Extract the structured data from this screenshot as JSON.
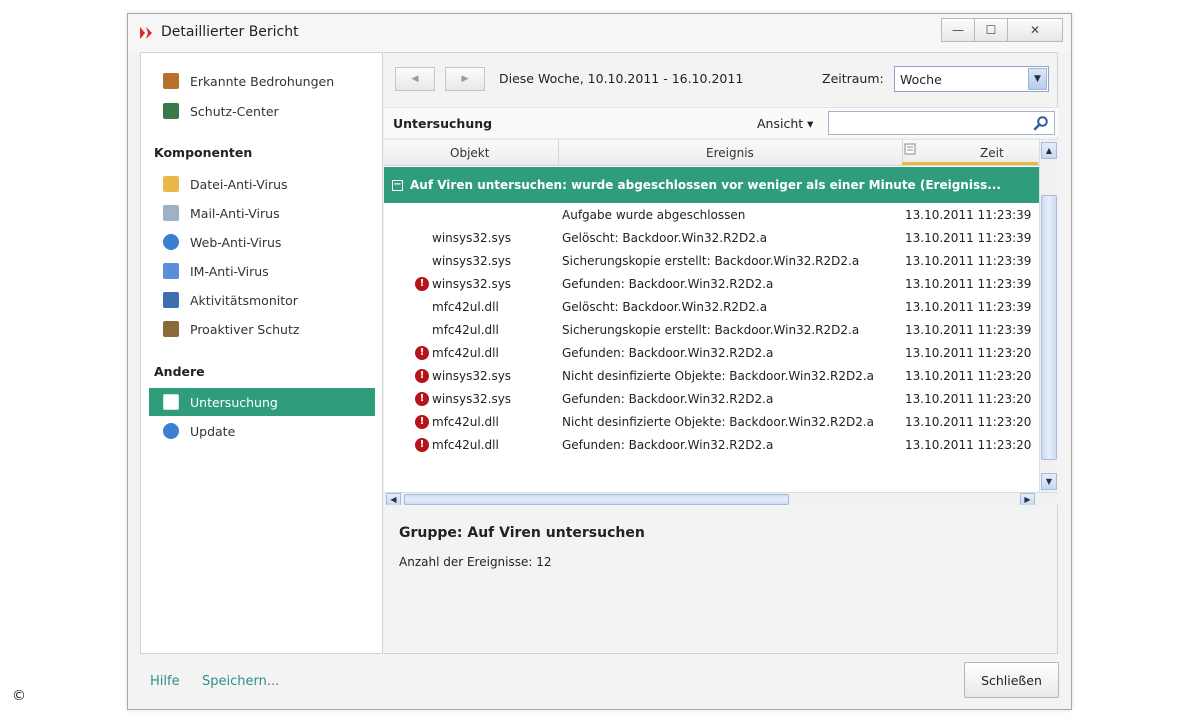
{
  "window": {
    "title": "Detaillierter Bericht",
    "controls": {
      "minimize": "—",
      "maximize": "☐",
      "close": "✕"
    }
  },
  "sidebar": {
    "top_items": [
      {
        "label": "Erkannte Bedrohungen",
        "icon": "threats-icon",
        "color": "#b8702a"
      },
      {
        "label": "Schutz-Center",
        "icon": "protection-center-icon",
        "color": "#3a7a4a"
      }
    ],
    "components_heading": "Komponenten",
    "components": [
      {
        "label": "Datei-Anti-Virus",
        "icon": "folder-icon",
        "color": "#e8b84a"
      },
      {
        "label": "Mail-Anti-Virus",
        "icon": "mail-icon",
        "color": "#9fb1c6"
      },
      {
        "label": "Web-Anti-Virus",
        "icon": "globe-icon",
        "color": "#3a7fd0"
      },
      {
        "label": "IM-Anti-Virus",
        "icon": "chat-icon",
        "color": "#5a8fd8"
      },
      {
        "label": "Aktivitätsmonitor",
        "icon": "monitor-icon",
        "color": "#3d6fae"
      },
      {
        "label": "Proaktiver Schutz",
        "icon": "shield-icon",
        "color": "#8a6a3a"
      }
    ],
    "other_heading": "Andere",
    "other": [
      {
        "label": "Untersuchung",
        "icon": "scan-icon",
        "color": "#ffffff",
        "active": true
      },
      {
        "label": "Update",
        "icon": "update-icon",
        "color": "#3a7fd0",
        "active": false
      }
    ]
  },
  "toolbar": {
    "back": "◀",
    "forward": "▶",
    "week_text": "Diese Woche, 10.10.2011 - 16.10.2011",
    "period_label": "Zeitraum:",
    "period_value": "Woche"
  },
  "section": {
    "title": "Untersuchung",
    "view_label": "Ansicht ▾",
    "search_value": ""
  },
  "table": {
    "columns": {
      "object": "Objekt",
      "event": "Ereignis",
      "time": "Zeit"
    },
    "group_label": "Auf Viren untersuchen: wurde abgeschlossen vor weniger als einer Minute  (Ereigniss...",
    "rows": [
      {
        "error": false,
        "object": "",
        "event": "Aufgabe wurde abgeschlossen",
        "time": "13.10.2011 11:23:39"
      },
      {
        "error": false,
        "object": "winsys32.sys",
        "event": "Gelöscht: Backdoor.Win32.R2D2.a",
        "time": "13.10.2011 11:23:39"
      },
      {
        "error": false,
        "object": "winsys32.sys",
        "event": "Sicherungskopie erstellt: Backdoor.Win32.R2D2.a",
        "time": "13.10.2011 11:23:39"
      },
      {
        "error": true,
        "object": "winsys32.sys",
        "event": "Gefunden: Backdoor.Win32.R2D2.a",
        "time": "13.10.2011 11:23:39"
      },
      {
        "error": false,
        "object": "mfc42ul.dll",
        "event": "Gelöscht: Backdoor.Win32.R2D2.a",
        "time": "13.10.2011 11:23:39"
      },
      {
        "error": false,
        "object": "mfc42ul.dll",
        "event": "Sicherungskopie erstellt: Backdoor.Win32.R2D2.a",
        "time": "13.10.2011 11:23:39"
      },
      {
        "error": true,
        "object": "mfc42ul.dll",
        "event": "Gefunden: Backdoor.Win32.R2D2.a",
        "time": "13.10.2011 11:23:20"
      },
      {
        "error": true,
        "object": "winsys32.sys",
        "event": "Nicht desinfizierte Objekte: Backdoor.Win32.R2D2.a",
        "time": "13.10.2011 11:23:20"
      },
      {
        "error": true,
        "object": "winsys32.sys",
        "event": "Gefunden: Backdoor.Win32.R2D2.a",
        "time": "13.10.2011 11:23:20"
      },
      {
        "error": true,
        "object": "mfc42ul.dll",
        "event": "Nicht desinfizierte Objekte: Backdoor.Win32.R2D2.a",
        "time": "13.10.2011 11:23:20"
      },
      {
        "error": true,
        "object": "mfc42ul.dll",
        "event": "Gefunden: Backdoor.Win32.R2D2.a",
        "time": "13.10.2011 11:23:20"
      }
    ]
  },
  "details": {
    "group_title": "Gruppe: Auf Viren untersuchen",
    "event_count": "Anzahl der Ereignisse: 12"
  },
  "footer": {
    "help": "Hilfe",
    "save": "Speichern...",
    "close": "Schließen"
  },
  "copyright": "©",
  "colors": {
    "accent": "#2f9d7c",
    "error": "#b5141b",
    "link": "#2f8f8a"
  }
}
